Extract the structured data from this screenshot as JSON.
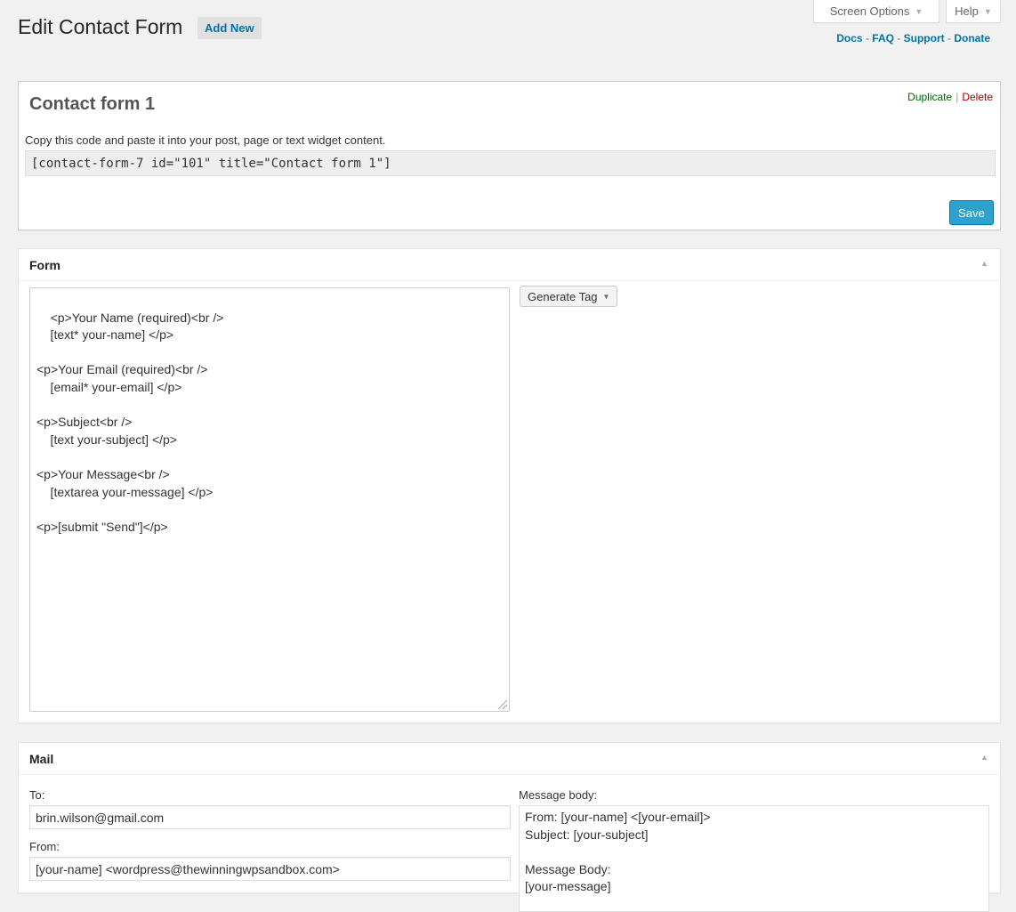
{
  "header": {
    "title": "Edit Contact Form",
    "add_new": "Add New",
    "screen_options": "Screen Options",
    "help": "Help",
    "links": {
      "docs": "Docs",
      "faq": "FAQ",
      "support": "Support",
      "donate": "Donate",
      "separator": "-"
    }
  },
  "title_box": {
    "form_name": "Contact form 1",
    "duplicate": "Duplicate",
    "delete": "Delete",
    "copy_hint": "Copy this code and paste it into your post, page or text widget content.",
    "shortcode": "[contact-form-7 id=\"101\" title=\"Contact form 1\"]",
    "save": "Save"
  },
  "form_section": {
    "heading": "Form",
    "content": "<p>Your Name (required)<br />\n    [text* your-name] </p>\n\n<p>Your Email (required)<br />\n    [email* your-email] </p>\n\n<p>Subject<br />\n    [text your-subject] </p>\n\n<p>Your Message<br />\n    [textarea your-message] </p>\n\n<p>[submit \"Send\"]</p>",
    "generate_tag": "Generate Tag"
  },
  "mail_section": {
    "heading": "Mail",
    "to_label": "To:",
    "to_value": "brin.wilson@gmail.com",
    "from_label": "From:",
    "from_value": "[your-name] <wordpress@thewinningwpsandbox.com>",
    "message_body_label": "Message body:",
    "message_body": "From: [your-name] <[your-email]>\nSubject: [your-subject]\n\nMessage Body:\n[your-message]"
  },
  "colors": {
    "link": "#0073aa",
    "save_button": "#2ea2cc",
    "duplicate": "#006505",
    "delete": "#a00"
  }
}
